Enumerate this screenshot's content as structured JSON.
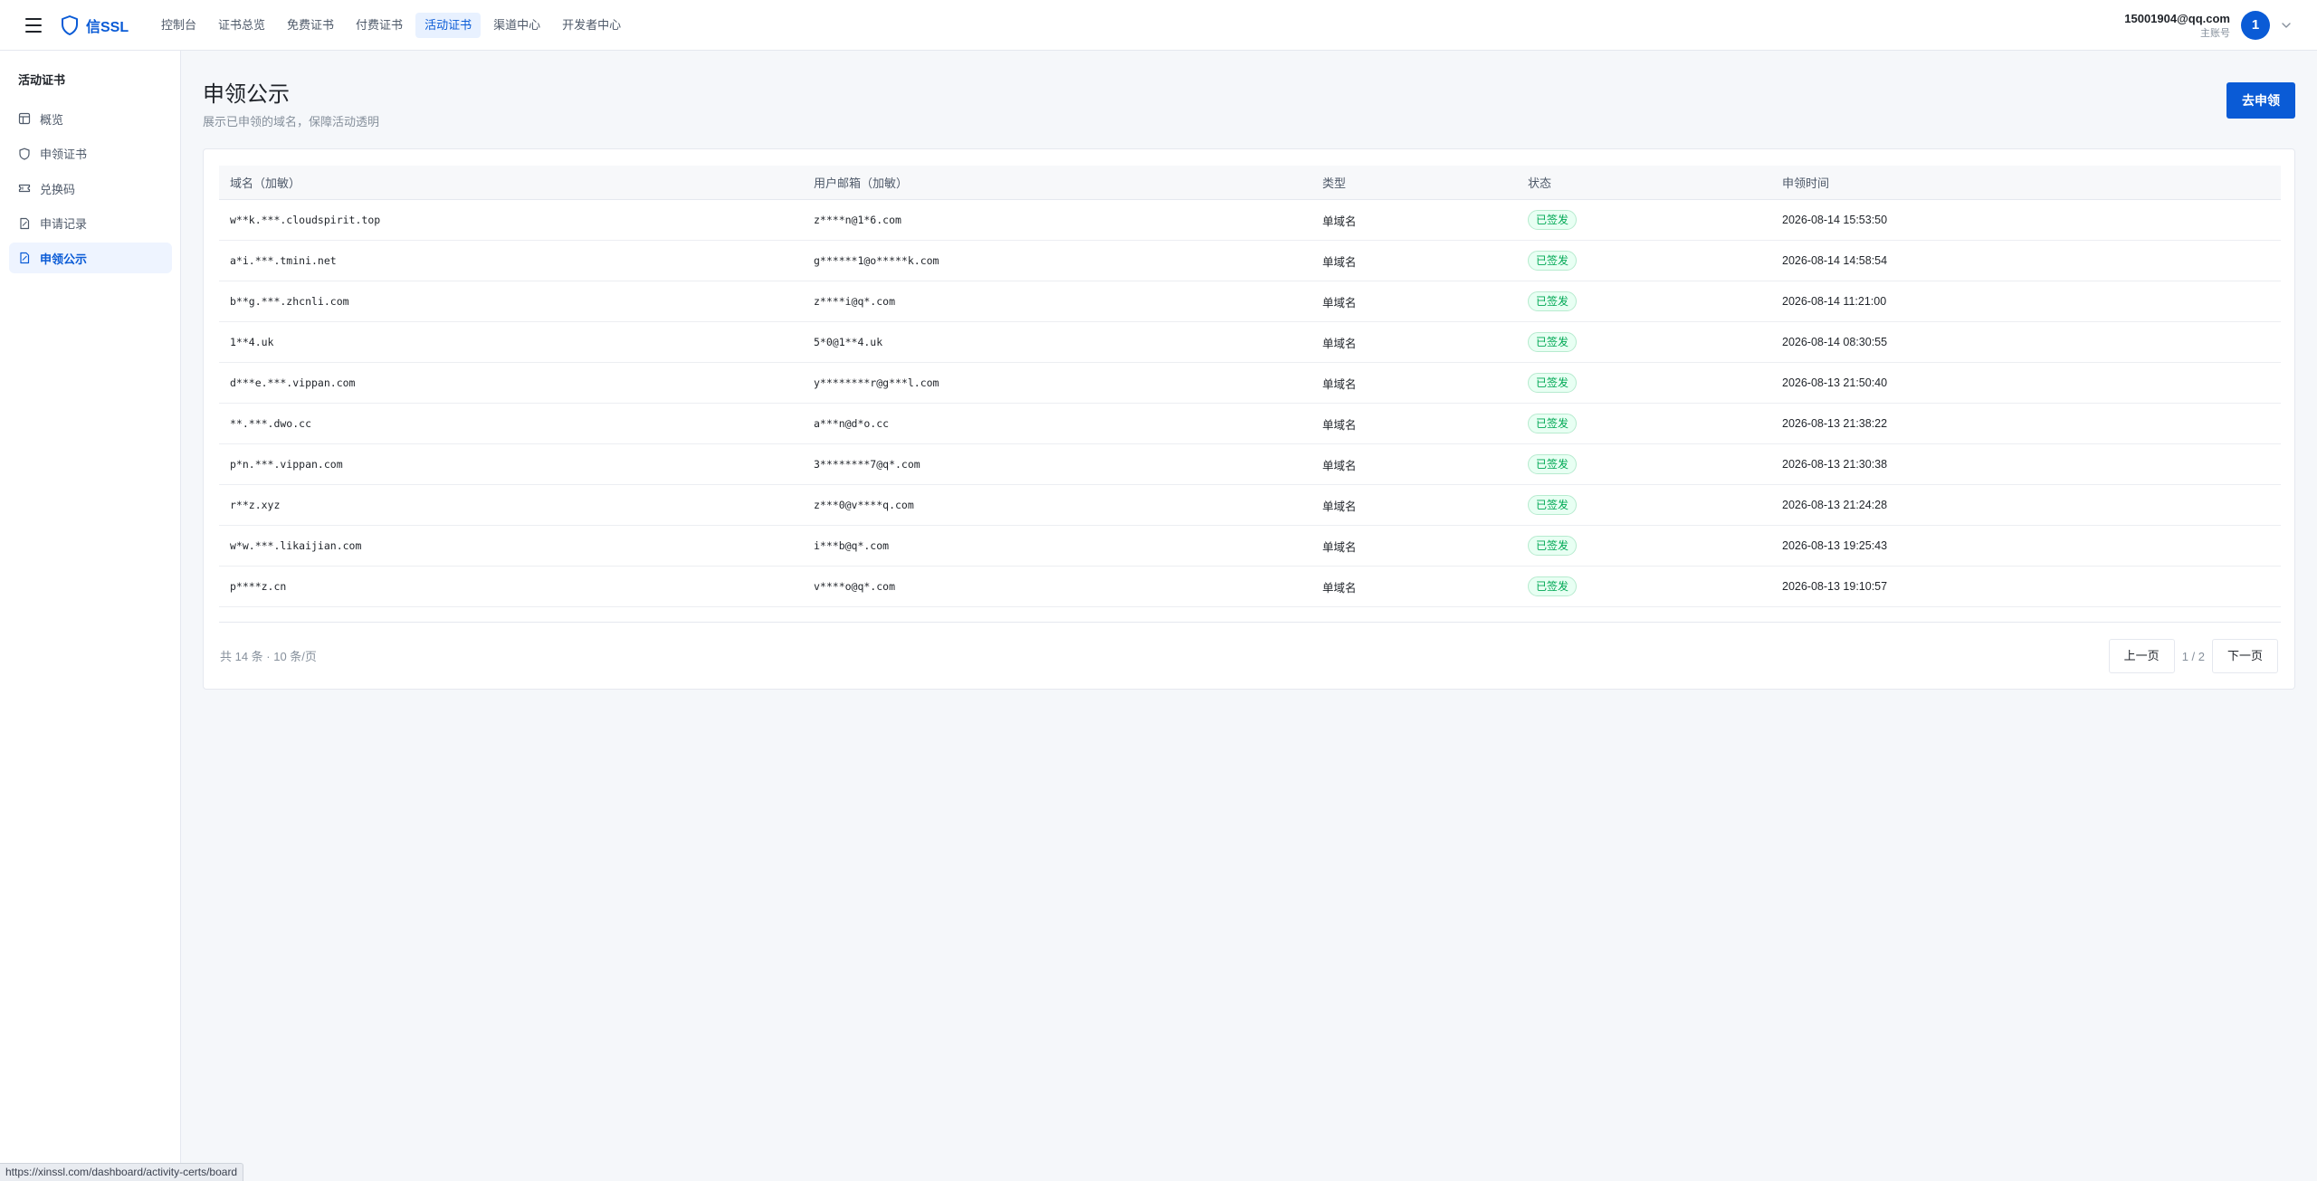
{
  "header": {
    "brand": "信SSL",
    "nav": [
      {
        "label": "控制台",
        "active": false
      },
      {
        "label": "证书总览",
        "active": false
      },
      {
        "label": "免费证书",
        "active": false
      },
      {
        "label": "付费证书",
        "active": false
      },
      {
        "label": "活动证书",
        "active": true
      },
      {
        "label": "渠道中心",
        "active": false
      },
      {
        "label": "开发者中心",
        "active": false
      }
    ],
    "account": {
      "email": "15001904@qq.com",
      "role": "主账号",
      "avatar_initial": "1"
    }
  },
  "sidebar": {
    "title": "活动证书",
    "items": [
      {
        "label": "概览",
        "icon": "layout-icon",
        "active": false
      },
      {
        "label": "申领证书",
        "icon": "shield-icon",
        "active": false
      },
      {
        "label": "兑换码",
        "icon": "ticket-icon",
        "active": false
      },
      {
        "label": "申请记录",
        "icon": "document-icon",
        "active": false
      },
      {
        "label": "申领公示",
        "icon": "document-icon",
        "active": true
      }
    ]
  },
  "main": {
    "title": "申领公示",
    "subtitle": "展示已申领的域名，保障活动透明",
    "apply_button": "去申领",
    "table": {
      "headers": {
        "domain": "域名（加敏）",
        "email": "用户邮箱（加敏）",
        "type": "类型",
        "status": "状态",
        "time": "申领时间"
      },
      "rows": [
        {
          "domain": "w**k.***.cloudspirit.top",
          "email": "z****n@1*6.com",
          "type": "单域名",
          "status": "已签发",
          "time": "2026-08-14 15:53:50"
        },
        {
          "domain": "a*i.***.tmini.net",
          "email": "g******1@o*****k.com",
          "type": "单域名",
          "status": "已签发",
          "time": "2026-08-14 14:58:54"
        },
        {
          "domain": "b**g.***.zhcnli.com",
          "email": "z****i@q*.com",
          "type": "单域名",
          "status": "已签发",
          "time": "2026-08-14 11:21:00"
        },
        {
          "domain": "1**4.uk",
          "email": "5*0@1**4.uk",
          "type": "单域名",
          "status": "已签发",
          "time": "2026-08-14 08:30:55"
        },
        {
          "domain": "d***e.***.vippan.com",
          "email": "y********r@g***l.com",
          "type": "单域名",
          "status": "已签发",
          "time": "2026-08-13 21:50:40"
        },
        {
          "domain": "**.***.dwo.cc",
          "email": "a***n@d*o.cc",
          "type": "单域名",
          "status": "已签发",
          "time": "2026-08-13 21:38:22"
        },
        {
          "domain": "p*n.***.vippan.com",
          "email": "3********7@q*.com",
          "type": "单域名",
          "status": "已签发",
          "time": "2026-08-13 21:30:38"
        },
        {
          "domain": "r**z.xyz",
          "email": "z***0@v****q.com",
          "type": "单域名",
          "status": "已签发",
          "time": "2026-08-13 21:24:28"
        },
        {
          "domain": "w*w.***.likaijian.com",
          "email": "i***b@q*.com",
          "type": "单域名",
          "status": "已签发",
          "time": "2026-08-13 19:25:43"
        },
        {
          "domain": "p****z.cn",
          "email": "v****o@q*.com",
          "type": "单域名",
          "status": "已签发",
          "time": "2026-08-13 19:10:57"
        }
      ]
    },
    "pagination": {
      "summary": "共 14 条 · 10 条/页",
      "prev": "上一页",
      "page_info": "1 / 2",
      "next": "下一页"
    }
  },
  "status_bar": {
    "url": "https://xinssl.com/dashboard/activity-certs/board"
  },
  "colors": {
    "brand": "#0a5bd6",
    "status_issued": "#00a854",
    "background": "#f5f7fa"
  }
}
